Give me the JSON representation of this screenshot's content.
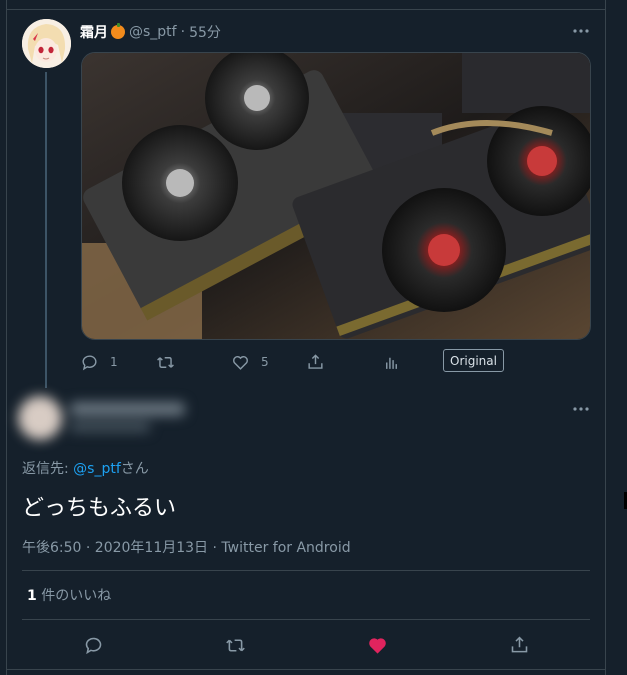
{
  "tweet": {
    "author_name": "霜月",
    "handle": "@s_ptf",
    "separator": "·",
    "time": "55分",
    "reply_count": "1",
    "like_count": "5",
    "original_label": "Original",
    "more_icon": "more-icon"
  },
  "reply": {
    "reply_label": "返信先: ",
    "reply_mention": "@s_ptf",
    "reply_suffix": "さん",
    "text": "どっちもふるい",
    "meta": "午後6:50 · 2020年11月13日 · Twitter for Android",
    "likes_count": "1",
    "likes_label": " 件のいいね"
  },
  "colors": {
    "background": "#15202b",
    "border": "#38444d",
    "muted": "#8899a6",
    "link": "#1da1f2",
    "like_active": "#e0245e"
  }
}
